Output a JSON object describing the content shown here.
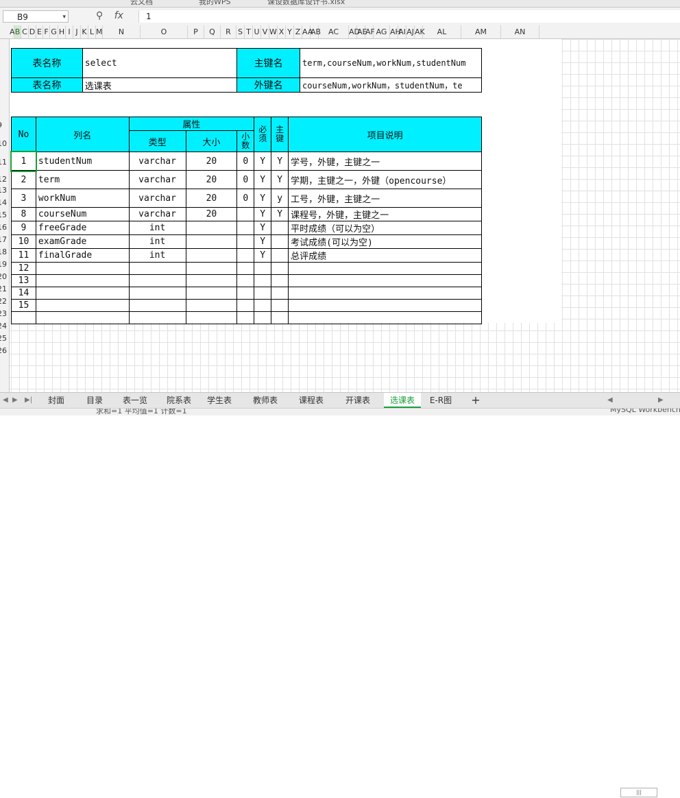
{
  "top_strip": {
    "items": [
      "云文档",
      "我的WPS",
      "课设数据库设计书.xlsx"
    ]
  },
  "formula_bar": {
    "cell_ref": "B9",
    "fx_label": "fx",
    "value": "1"
  },
  "columns": [
    "A",
    "B",
    "C",
    "D",
    "E",
    "F",
    "G",
    "H",
    "I",
    "J",
    "K",
    "L",
    "M",
    "N",
    "O",
    "P",
    "Q",
    "R",
    "S",
    "T",
    "U",
    "V",
    "W",
    "X",
    "Y",
    "Z",
    "AA",
    "AB",
    "AC",
    "AD",
    "AE",
    "AF",
    "AG",
    "AH",
    "AI",
    "AJ",
    "AK",
    "AL",
    "AM",
    "AN"
  ],
  "rows": [
    "9",
    "10",
    "11",
    "12",
    "13",
    "14",
    "15",
    "16",
    "17",
    "18",
    "19",
    "20",
    "21",
    "22",
    "23",
    "24",
    "25",
    "26"
  ],
  "table_info": {
    "r1": {
      "label": "表名称",
      "value": "select",
      "key_label": "主键名",
      "key_value": "term,courseNum,workNum,studentNum"
    },
    "r2": {
      "label": "表名称",
      "value": "选课表",
      "key_label": "外键名",
      "key_value": "courseNum,workNum，studentNum，te"
    }
  },
  "header": {
    "no": "No",
    "col_name": "列名",
    "attr": "属性",
    "type": "类型",
    "size": "大小",
    "decimal_1": "小",
    "decimal_2": "数",
    "req_1": "必",
    "req_2": "须",
    "pk_1": "主",
    "pk_2": "键",
    "desc": "项目说明"
  },
  "fields": [
    {
      "no": "1",
      "name": "studentNum",
      "type": "varchar",
      "size": "20",
      "dec": "0",
      "req": "Y",
      "pk": "Y",
      "desc": "学号，外键，主键之一"
    },
    {
      "no": "2",
      "name": "term",
      "type": "varchar",
      "size": "20",
      "dec": "0",
      "req": "Y",
      "pk": "Y",
      "desc": "学期，主键之一，外键（opencourse）"
    },
    {
      "no": "3",
      "name": "workNum",
      "type": "varchar",
      "size": "20",
      "dec": "0",
      "req": "Y",
      "pk": "y",
      "desc": "工号，外键，主键之一"
    },
    {
      "no": "8",
      "name": "courseNum",
      "type": "varchar",
      "size": "20",
      "dec": "",
      "req": "Y",
      "pk": "Y",
      "desc": "课程号，外键，主键之一"
    },
    {
      "no": "9",
      "name": "freeGrade",
      "type": "int",
      "size": "",
      "dec": "",
      "req": "Y",
      "pk": "",
      "desc": "平时成绩（可以为空）"
    },
    {
      "no": "10",
      "name": "examGrade",
      "type": "int",
      "size": "",
      "dec": "",
      "req": "Y",
      "pk": "",
      "desc": "考试成绩(可以为空)"
    },
    {
      "no": "11",
      "name": "finalGrade",
      "type": "int",
      "size": "",
      "dec": "",
      "req": "Y",
      "pk": "",
      "desc": "总评成绩"
    },
    {
      "no": "12",
      "name": "",
      "type": "",
      "size": "",
      "dec": "",
      "req": "",
      "pk": "",
      "desc": ""
    },
    {
      "no": "13",
      "name": "",
      "type": "",
      "size": "",
      "dec": "",
      "req": "",
      "pk": "",
      "desc": ""
    },
    {
      "no": "14",
      "name": "",
      "type": "",
      "size": "",
      "dec": "",
      "req": "",
      "pk": "",
      "desc": ""
    },
    {
      "no": "15",
      "name": "",
      "type": "",
      "size": "",
      "dec": "",
      "req": "",
      "pk": "",
      "desc": ""
    },
    {
      "no": "",
      "name": "",
      "type": "",
      "size": "",
      "dec": "",
      "req": "",
      "pk": "",
      "desc": ""
    }
  ],
  "sheet_tabs": [
    "封面",
    "目录",
    "表一览",
    "院系表",
    "学生表",
    "教师表",
    "课程表",
    "开课表",
    "选课表",
    "E-R图"
  ],
  "active_tab": "选课表",
  "add_tab": "+",
  "status_bar": {
    "text": "求和=1  平均值=1  计数=1",
    "right": "MySQL Workbench"
  },
  "colors": {
    "header_fill": "#00f0ff",
    "accent": "#1a9e3b"
  }
}
